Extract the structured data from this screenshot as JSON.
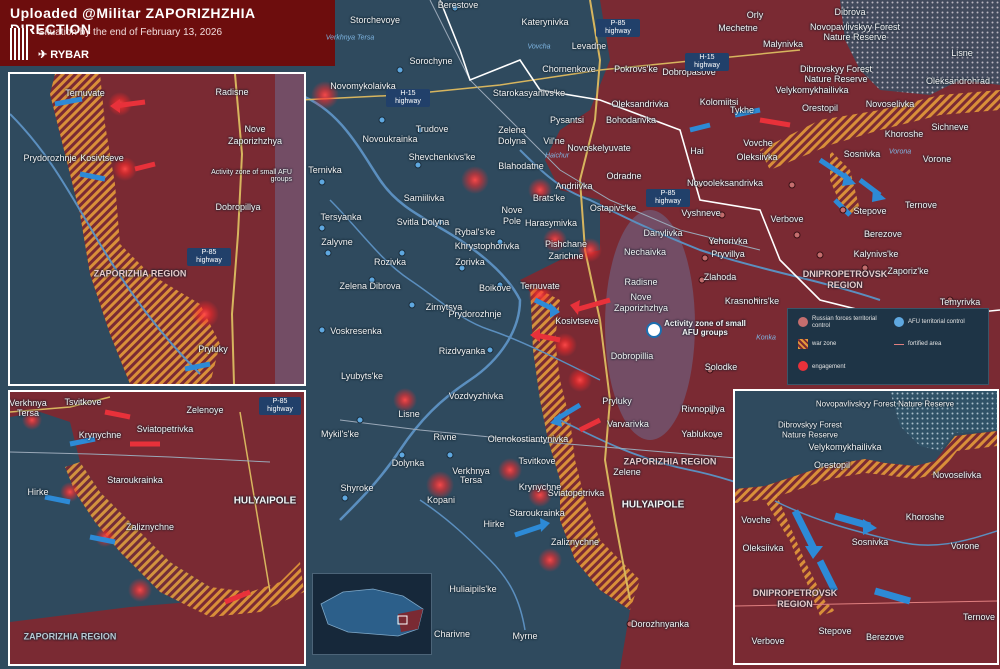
{
  "header": {
    "title": "Uploaded @Militar ZAPORIZHZHIA DIRECTION",
    "subtitle": "Situation by the end of February 13, 2026",
    "brand": "RYBAR"
  },
  "colors": {
    "russian_forces": "#7a2a33",
    "afu_territory": "#2f4a5e",
    "war_zone": "#e49a3a",
    "engagement": "#e8313a",
    "fortified_line": "#e08080",
    "header": "#6d0d0d"
  },
  "legend": {
    "russian_forces": "Russian forces territorial control",
    "afu_territory": "AFU territorial control",
    "war_zone": "war zone",
    "fortified_area": "fortified area",
    "engagement": "engagement"
  },
  "settlements": [
    "Storchevoye",
    "Berestove",
    "Katerynivka",
    "Orly",
    "Dibrova",
    "Novopavlivskyy Forest Nature Reserve",
    "Mechetne",
    "Malynivka",
    "Levadne",
    "Sorochyne",
    "Chornenkove",
    "Pokrovs'ke",
    "Dobropasove",
    "Dibrovskyy Forest Nature Reserve",
    "Lisne",
    "Novomykolaivka",
    "Starokasyanivs'ke",
    "Oleksandrivka",
    "Kolomiitsi",
    "Velykomykhailivka",
    "Oleksandrohrad",
    "Tykhe",
    "Orestopil",
    "Novoselivka",
    "Zelena Dolyna",
    "Vil'ne",
    "Pysantsi",
    "Bohodarivka",
    "Trudove",
    "Novoukrainka",
    "Novoskelyuvate",
    "Hai",
    "Khoroshe",
    "Sichneve",
    "Shevchenkivs'ke",
    "Vovche",
    "Oleksiivka",
    "Sosnivka",
    "Vorone",
    "Blahodatne",
    "Odradne",
    "Ternivka",
    "Andriivka",
    "Novooleksandrivka",
    "Samiilivka",
    "Brats'ke",
    "Ostapivs'ke",
    "Verbove",
    "Stepove",
    "Ternove",
    "Tersyanka",
    "Svitla Dolyna",
    "Rybal's'ke",
    "Nove Pole",
    "Harasymivka",
    "Vyshneve",
    "Khrystoforivka",
    "Danylivka",
    "Yehorivka",
    "Berezove",
    "Zalyvne",
    "Pishchane",
    "Zarichne",
    "Nechaivka",
    "Pryvillya",
    "Kalynivs'ke",
    "Zaporiz'ke",
    "Rozivka",
    "Zorivka",
    "Zlahoda",
    "Zelena Dibrova",
    "Boikove",
    "Ternuvate",
    "Radisne",
    "Krasnohirs'ke",
    "Temyrivka",
    "Zirnytsya",
    "Nove Zaporizhzhya",
    "Voskresenka",
    "Prydorozhnje",
    "Kosivtseve",
    "Rizdvyanka",
    "Dobropillia",
    "Lyubyts'ke",
    "Solodke",
    "Pryluky",
    "Vozdvyzhivka",
    "Lisne",
    "Rivnopillya",
    "Mykil's'ke",
    "Varvarivka",
    "Rivne",
    "Olenokostiantynivka",
    "Yablukove",
    "Dolynka",
    "Tsvitkove",
    "Verkhnya Tersa",
    "Zelene",
    "Shyroke",
    "Krynychne",
    "Kopani",
    "Sviatopetrivka",
    "Staroukrainka",
    "Hirke",
    "Zaliznychne",
    "Huliaipils'ke",
    "Dorozhnyanka",
    "Charivne",
    "Myrne"
  ],
  "main_labels": [
    {
      "text": "Storchevoye"
    },
    {
      "text": "Berestove"
    },
    {
      "text": "Katerynivka"
    },
    {
      "text": "Orly"
    },
    {
      "text": "Dibrova"
    },
    {
      "text": "Novopavlivskyy Forest"
    },
    {
      "text": "Nature Reserve"
    },
    {
      "text": "Mechetne"
    },
    {
      "text": "Malynivka"
    },
    {
      "text": "Levadne"
    },
    {
      "text": "Sorochyne"
    },
    {
      "text": "Chornenkove"
    },
    {
      "text": "Pokrovs'ke"
    },
    {
      "text": "Dobropasove"
    },
    {
      "text": "Dibrovskyy Forest"
    },
    {
      "text": "Nature Reserve"
    },
    {
      "text": "Lisne"
    },
    {
      "text": "Novomykolaivka"
    },
    {
      "text": "Starokasyanivs'ke"
    },
    {
      "text": "Oleksandrivka"
    },
    {
      "text": "Kolomiitsi"
    },
    {
      "text": "Velykomykhailivka"
    },
    {
      "text": "Oleksandrohrad"
    },
    {
      "text": "Tykhe"
    },
    {
      "text": "Orestopil"
    },
    {
      "text": "Novoselivka"
    },
    {
      "text": "Zelena"
    },
    {
      "text": "Dolyna"
    },
    {
      "text": "Vil'ne"
    },
    {
      "text": "Pysantsi"
    },
    {
      "text": "Bohodarivka"
    },
    {
      "text": "Trudove"
    },
    {
      "text": "Novoukrainka"
    },
    {
      "text": "Novoskelyuvate"
    },
    {
      "text": "Hai"
    },
    {
      "text": "Khoroshe"
    },
    {
      "text": "Sichneve"
    },
    {
      "text": "Shevchenkivs'ke"
    },
    {
      "text": "Vovche"
    },
    {
      "text": "Oleksiivka"
    },
    {
      "text": "Sosnivka"
    },
    {
      "text": "Vorone"
    },
    {
      "text": "Blahodatne"
    },
    {
      "text": "Odradne"
    },
    {
      "text": "Ternivka"
    },
    {
      "text": "Andriivka"
    },
    {
      "text": "Novooleksandrivka"
    },
    {
      "text": "Samiilivka"
    },
    {
      "text": "Brats'ke"
    },
    {
      "text": "Ostapivs'ke"
    },
    {
      "text": "Verbove"
    },
    {
      "text": "Stepove"
    },
    {
      "text": "Ternove"
    },
    {
      "text": "Tersyanka"
    },
    {
      "text": "Svitla Dolyna"
    },
    {
      "text": "Rybal's'ke"
    },
    {
      "text": "Nove"
    },
    {
      "text": "Pole"
    },
    {
      "text": "Harasymivka"
    },
    {
      "text": "Vyshneve"
    },
    {
      "text": "Khrystophorivka"
    },
    {
      "text": "Danylivka"
    },
    {
      "text": "Yehorivka"
    },
    {
      "text": "Berezove"
    },
    {
      "text": "Zalyvne"
    },
    {
      "text": "Pishchane"
    },
    {
      "text": "Zarichne"
    },
    {
      "text": "Nechaivka"
    },
    {
      "text": "Pryvillya"
    },
    {
      "text": "Kalynivs'ke"
    },
    {
      "text": "Zaporiz'ke"
    },
    {
      "text": "Rozivka"
    },
    {
      "text": "Zorivka"
    },
    {
      "text": "Zlahoda"
    },
    {
      "text": "Zelena Dibrova"
    },
    {
      "text": "Boikove"
    },
    {
      "text": "Ternuvate"
    },
    {
      "text": "Radisne"
    },
    {
      "text": "Krasnohirs'ke"
    },
    {
      "text": "Temyrivka"
    },
    {
      "text": "Zirnytsya"
    },
    {
      "text": "Nove"
    },
    {
      "text": "Zaporizhzhya"
    },
    {
      "text": "Voskresenka"
    },
    {
      "text": "Prydorozhnje"
    },
    {
      "text": "Kosivtseve"
    },
    {
      "text": "Rizdvyanka"
    },
    {
      "text": "Dobropillia"
    },
    {
      "text": "Lyubyts'ke"
    },
    {
      "text": "Solodke"
    },
    {
      "text": "Pryluky"
    },
    {
      "text": "Vozdvyzhivka"
    },
    {
      "text": "Lisne"
    },
    {
      "text": "Rivnopillya"
    },
    {
      "text": "Mykil's'ke"
    },
    {
      "text": "Varvarivka"
    },
    {
      "text": "Rivne"
    },
    {
      "text": "Olenokostiantynivka"
    },
    {
      "text": "Yablukove"
    },
    {
      "text": "Dolynka"
    },
    {
      "text": "Tsvitkove"
    },
    {
      "text": "Verkhnya"
    },
    {
      "text": "Tersa"
    },
    {
      "text": "Zelene"
    },
    {
      "text": "Shyroke"
    },
    {
      "text": "Krynychne"
    },
    {
      "text": "Kopani"
    },
    {
      "text": "Sviatopetrivka"
    },
    {
      "text": "HULYAIPOLE"
    },
    {
      "text": "Staroukrainka"
    },
    {
      "text": "Hirke"
    },
    {
      "text": "Zaliznychne"
    },
    {
      "text": "Huliaipils'ke"
    },
    {
      "text": "Dorozhnyanka"
    },
    {
      "text": "Charivne"
    },
    {
      "text": "Myrne"
    }
  ],
  "regions": {
    "zaporizhia_main": "ZAPORIZHIA REGION",
    "dnipro_main": "DNIPROPETROVSK REGION",
    "zaporizhia_inset_left": "ZAPORIZHIA REGION",
    "zaporizhia_inset_bottom": "ZAPORIZHIA REGION",
    "dnipro_inset_right": "DNIPROPETROVSK REGION"
  },
  "activity_zone": "Activity zone of small AFU groups",
  "highways": {
    "p85_main_top": "P-85 highway",
    "h15_main": "H-15 highway",
    "h15_top": "H-15 highway",
    "p85_main_mid": "P-85 highway",
    "p85_inset1": "P-85 highway",
    "p85_inset2": "P-85 highway"
  },
  "rivers": {
    "vovcha": "Vovcha",
    "haichur": "Haichur",
    "verkhnya_tersa": "Verkhnya Tersa",
    "konka": "Konka",
    "vorona": "Vorona"
  },
  "inset1": {
    "labels": [
      "Ternuvate",
      "Radisne",
      "Nove",
      "Zaporizhzhya",
      "Prydorozhnje",
      "Kosivtseve",
      "Dobropillya",
      "Pryluky"
    ],
    "region": "ZAPORIZHIA REGION",
    "activity": "Activity zone of small AFU groups",
    "highway": "P-85 highway"
  },
  "inset2": {
    "labels": [
      "Verkhnya",
      "Tersa",
      "Tsvitkove",
      "Zelenoye",
      "Krynychne",
      "Sviatopetrivka",
      "Staroukrainka",
      "Hirke",
      "HULYAIPOLE",
      "Zaliznychne"
    ],
    "region": "ZAPORIZHIA REGION",
    "highway": "P-85 highway"
  },
  "inset3": {
    "labels": [
      "Novopavlivskyy Forest Nature Reserve",
      "Dibrovskyy Forest",
      "Nature Reserve",
      "Velykomykhailivka",
      "Orestopil",
      "Novoselivka",
      "Vovche",
      "Khoroshe",
      "Oleksiivka",
      "Sosnivka",
      "Vorone",
      "Ternove",
      "Verbove",
      "Stepove",
      "Berezove"
    ],
    "region": "DNIPROPETROVSK REGION"
  }
}
